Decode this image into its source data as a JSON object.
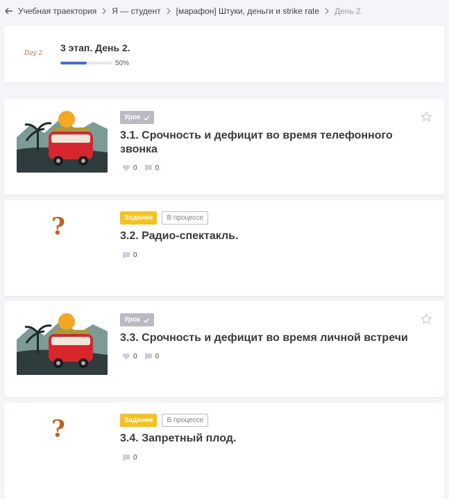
{
  "breadcrumb": {
    "items": [
      "Учебная траектория",
      "Я — студент",
      "[марафон] Штуки, деньги и strike rate",
      "День 2."
    ]
  },
  "header": {
    "logo_text": "Day 2",
    "title": "3 этап. День 2.",
    "progress": 50,
    "progress_label": "50%"
  },
  "cards": [
    {
      "type_label": "Урок",
      "title": "3.1. Срочность и дефицит во время телефонного звонка",
      "likes": "0",
      "comments": "0"
    },
    {
      "type_label": "Задание",
      "status_label": "В процессе",
      "title": "3.2. Радио-спектакль.",
      "comments": "0",
      "placeholder": "?"
    },
    {
      "type_label": "Урок",
      "title": "3.3. Срочность и дефицит во время личной встречи",
      "likes": "0",
      "comments": "0"
    },
    {
      "type_label": "Задание",
      "status_label": "В процессе",
      "title": "3.4. Запретный плод.",
      "comments": "0",
      "placeholder": "?"
    }
  ],
  "colors": {
    "accent": "#3b6fe0",
    "task_tag": "#f7c21a",
    "lesson_tag": "#b8bcc2"
  },
  "icons": {
    "back": "arrow-left-icon",
    "separator": "chevron-right-icon",
    "like": "heart-icon",
    "comment": "comment-icon",
    "favorite": "star-icon",
    "done": "check-icon"
  }
}
